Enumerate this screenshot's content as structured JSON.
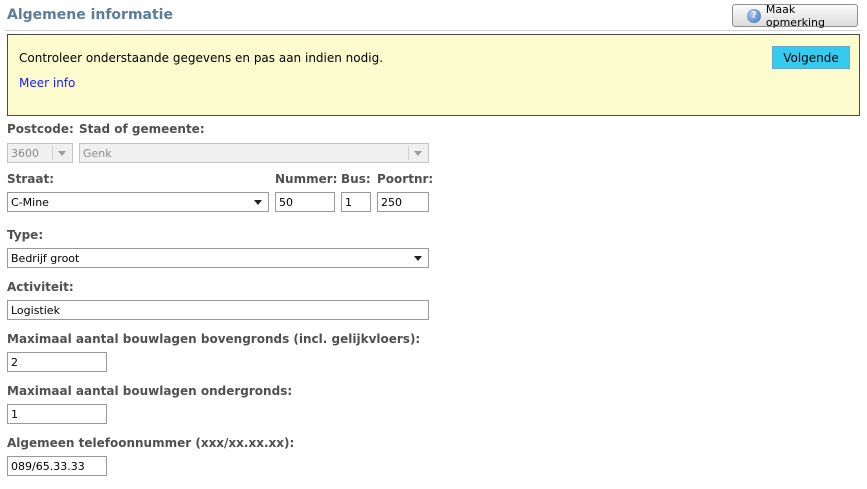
{
  "header": {
    "title": "Algemene informatie",
    "remark_button": "Maak opmerking"
  },
  "info": {
    "message": "Controleer onderstaande gegevens en pas aan indien nodig.",
    "link": "Meer info",
    "next_button": "Volgende"
  },
  "form": {
    "postcode": {
      "label": "Postcode:",
      "value": "3600"
    },
    "city": {
      "label": "Stad of gemeente:",
      "value": "Genk"
    },
    "street": {
      "label": "Straat:",
      "value": "C-Mine"
    },
    "number": {
      "label": "Nummer:",
      "value": "50"
    },
    "bus": {
      "label": "Bus:",
      "value": "1"
    },
    "gate": {
      "label": "Poortnr:",
      "value": "250"
    },
    "type": {
      "label": "Type:",
      "value": "Bedrijf groot"
    },
    "activity": {
      "label": "Activiteit:",
      "value": "Logistiek"
    },
    "floors_above": {
      "label": "Maximaal aantal bouwlagen bovengronds (incl. gelijkvloers):",
      "value": "2"
    },
    "floors_below": {
      "label": "Maximaal aantal bouwlagen ondergronds:",
      "value": "1"
    },
    "phone": {
      "label": "Algemeen telefoonnummer (xxx/xx.xx.xx):",
      "value": "089/65.33.33"
    }
  },
  "icons": {
    "help": "help-icon",
    "dropdown": "chevron-down-icon"
  },
  "colors": {
    "title": "#5a7d9a",
    "info_background": "#fcfbce",
    "next_button": "#33ccf0",
    "link": "#1a1aee"
  }
}
